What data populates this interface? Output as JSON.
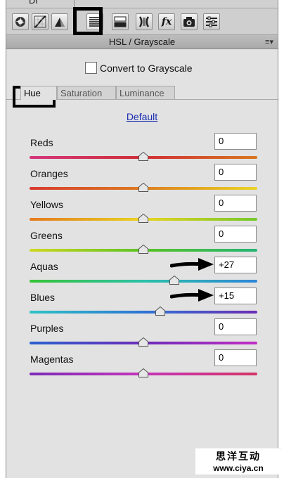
{
  "top_fragment": "Dr",
  "toolbar": {
    "buttons": [
      {
        "name": "basic-icon",
        "active": false
      },
      {
        "name": "tone-curve-icon",
        "active": false
      },
      {
        "name": "detail-icon",
        "active": false
      },
      {
        "name": "hsl-grayscale-icon",
        "active": true
      },
      {
        "name": "split-toning-icon",
        "active": false
      },
      {
        "name": "lens-corrections-icon",
        "active": false
      },
      {
        "name": "fx-effects-icon",
        "active": false
      },
      {
        "name": "camera-calibration-icon",
        "active": false
      },
      {
        "name": "presets-icon",
        "active": false
      }
    ],
    "fx_label": "fx"
  },
  "panel": {
    "title": "HSL / Grayscale",
    "menu_icon": "panel-menu-icon"
  },
  "grayscale": {
    "label": "Convert to Grayscale",
    "checked": false
  },
  "tabs": [
    {
      "label": "Hue",
      "active": true
    },
    {
      "label": "Saturation",
      "active": false
    },
    {
      "label": "Luminance",
      "active": false
    }
  ],
  "default_link": "Default",
  "sliders": [
    {
      "label": "Reds",
      "value": "0",
      "level": 0
    },
    {
      "label": "Oranges",
      "value": "0",
      "level": 0
    },
    {
      "label": "Yellows",
      "value": "0",
      "level": 0
    },
    {
      "label": "Greens",
      "value": "0",
      "level": 0
    },
    {
      "label": "Aquas",
      "value": "+27",
      "level": 27
    },
    {
      "label": "Blues",
      "value": "+15",
      "level": 15
    },
    {
      "label": "Purples",
      "value": "0",
      "level": 0
    },
    {
      "label": "Magentas",
      "value": "0",
      "level": 0
    }
  ],
  "slider_range": [
    -100,
    100
  ],
  "annotation_arrows_on": [
    "Aquas",
    "Blues"
  ],
  "watermark": {
    "cn": "思洋互动",
    "url": "www.ciya.cn"
  }
}
